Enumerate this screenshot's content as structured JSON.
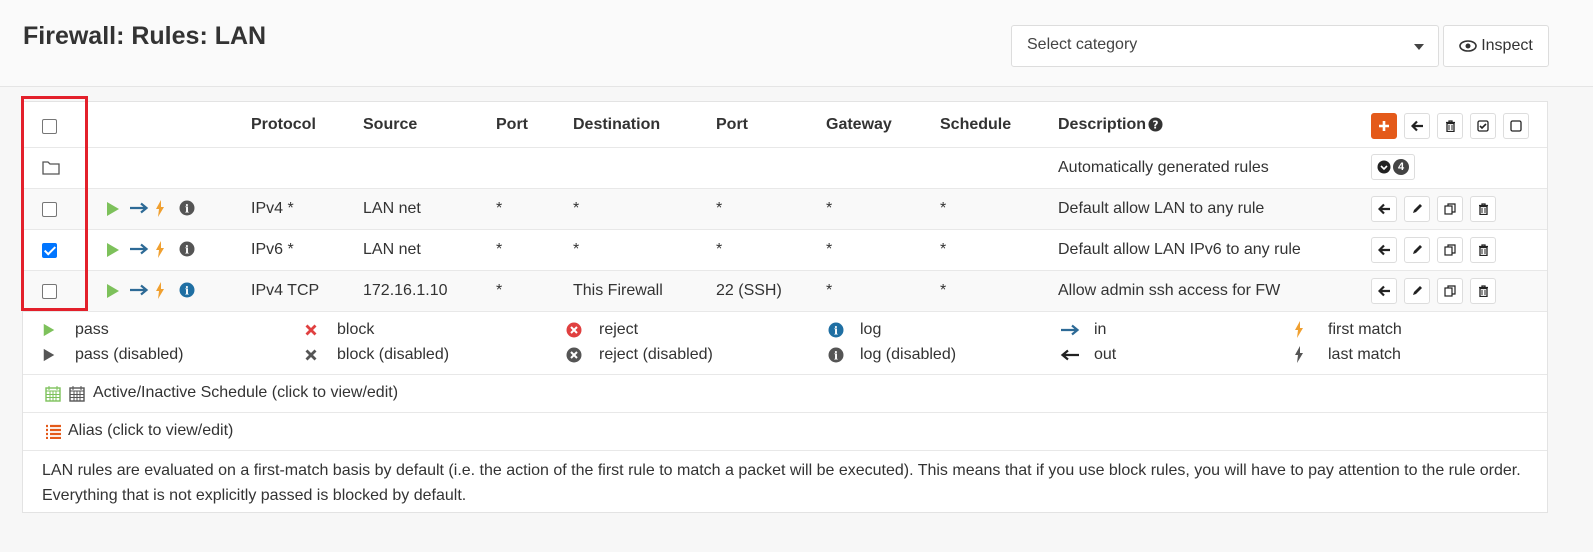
{
  "page": {
    "title": "Firewall: Rules: LAN"
  },
  "toolbar": {
    "category_placeholder": "Select category",
    "inspect_label": "Inspect"
  },
  "table": {
    "headers": [
      "Protocol",
      "Source",
      "Port",
      "Destination",
      "Port",
      "Gateway",
      "Schedule",
      "Description"
    ],
    "auto_rules": {
      "label": "Automatically generated rules",
      "count": "4"
    },
    "rows": [
      {
        "checked": false,
        "protocol": "IPv4 *",
        "source": "LAN net",
        "src_port": "*",
        "destination": "*",
        "dst_port": "*",
        "gateway": "*",
        "schedule": "*",
        "description": "Default allow LAN to any rule",
        "info_active": false
      },
      {
        "checked": true,
        "protocol": "IPv6 *",
        "source": "LAN net",
        "src_port": "*",
        "destination": "*",
        "dst_port": "*",
        "gateway": "*",
        "schedule": "*",
        "description": "Default allow LAN IPv6 to any rule",
        "info_active": false
      },
      {
        "checked": false,
        "protocol": "IPv4 TCP",
        "source": "172.16.1.10",
        "src_port": "*",
        "destination": "This Firewall",
        "dst_port": "22 (SSH)",
        "gateway": "*",
        "schedule": "*",
        "description": "Allow admin ssh access for FW",
        "info_active": true
      }
    ]
  },
  "legend": {
    "pass": "pass",
    "pass_disabled": "pass (disabled)",
    "block": "block",
    "block_disabled": "block (disabled)",
    "reject": "reject",
    "reject_disabled": "reject (disabled)",
    "log": "log",
    "log_disabled": "log (disabled)",
    "in": "in",
    "out": "out",
    "first_match": "first match",
    "last_match": "last match",
    "schedule": "Active/Inactive Schedule (click to view/edit)",
    "alias": "Alias (click to view/edit)",
    "note": "LAN rules are evaluated on a first-match basis by default (i.e. the action of the first rule to match a packet will be executed). This means that if you use block rules, you will have to pay attention to the rule order. Everything that is not explicitly passed is blocked by default."
  },
  "colors": {
    "accent": "#e45a1a",
    "pass": "#7dc15b",
    "block": "#e04040",
    "in_arrow": "#2d6a96",
    "bolt": "#f0a030",
    "highlight": "#e3202b"
  }
}
